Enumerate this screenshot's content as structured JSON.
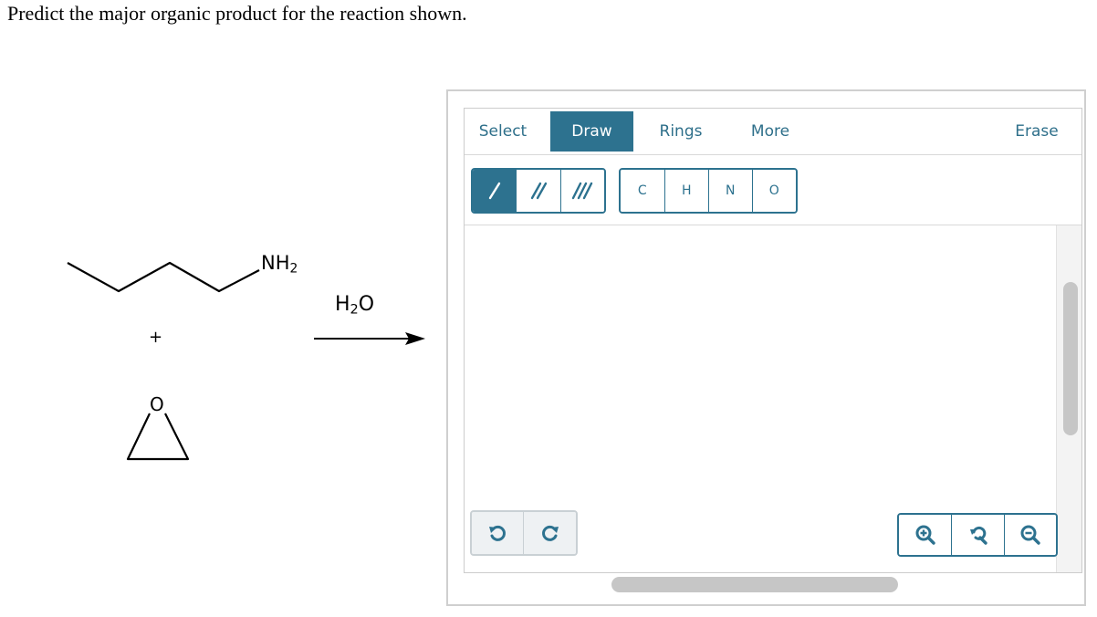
{
  "question": "Predict the major organic product for the reaction shown.",
  "reaction": {
    "amine_label": "NH",
    "amine_subscript": "2",
    "plus": "+",
    "epoxide_oxygen": "O",
    "reagent_main": "H",
    "reagent_subscript": "2",
    "reagent_tail": "O"
  },
  "editor": {
    "tabs": [
      {
        "label": "Select",
        "active": false
      },
      {
        "label": "Draw",
        "active": true
      },
      {
        "label": "Rings",
        "active": false
      },
      {
        "label": "More",
        "active": false
      },
      {
        "label": "Erase",
        "active": false
      }
    ],
    "bond_tools": [
      {
        "icon": "single-bond-icon",
        "active": true
      },
      {
        "icon": "double-bond-icon",
        "active": false
      },
      {
        "icon": "triple-bond-icon",
        "active": false
      }
    ],
    "atom_tools": [
      "C",
      "H",
      "N",
      "O"
    ],
    "history_tools": [
      {
        "icon": "undo-icon"
      },
      {
        "icon": "redo-icon"
      }
    ],
    "zoom_tools": [
      {
        "icon": "zoom-in-icon"
      },
      {
        "icon": "reset-zoom-icon"
      },
      {
        "icon": "zoom-out-icon"
      }
    ]
  },
  "colors": {
    "accent": "#2d728f",
    "tab_text": "#2e6f8a",
    "scrollbar": "#c6c6c6"
  }
}
